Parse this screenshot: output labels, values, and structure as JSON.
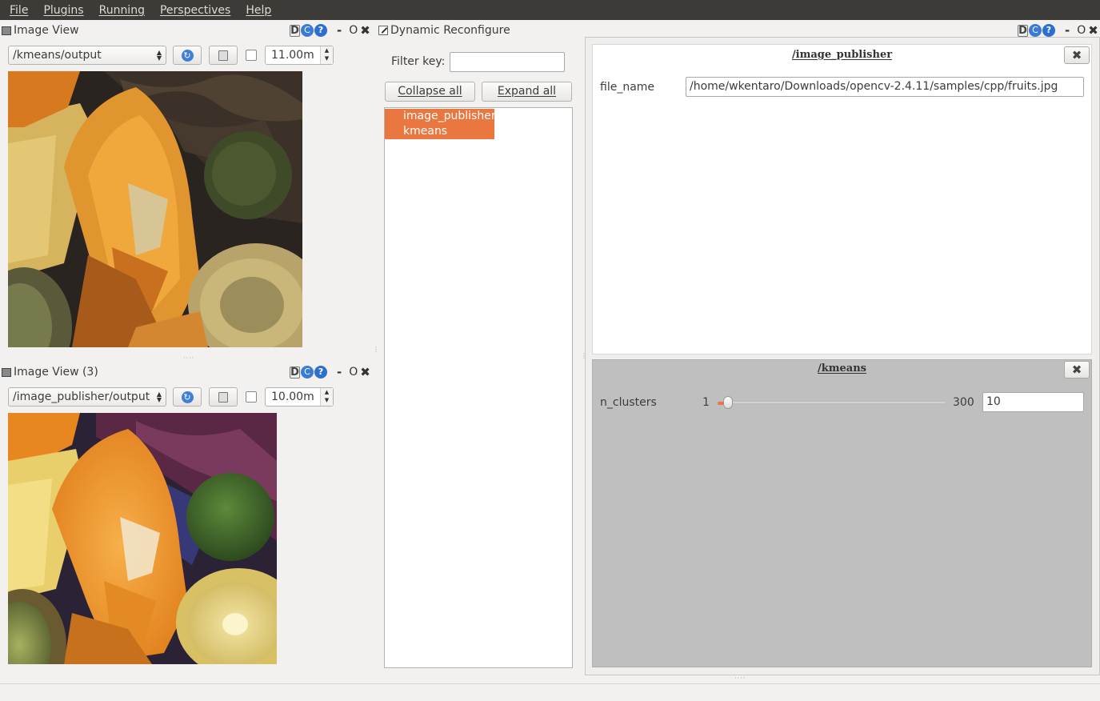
{
  "menubar": {
    "items": [
      "File",
      "Plugins",
      "Running",
      "Perspectives",
      "Help"
    ]
  },
  "image_view_1": {
    "title": "Image View",
    "topic": "/kmeans/output",
    "zoom_value": "11.00m"
  },
  "image_view_2": {
    "title": "Image View (3)",
    "topic": "/image_publisher/output",
    "zoom_value": "10.00m"
  },
  "dock_controls": {
    "d_label": "D",
    "c_label": "C",
    "help_label": "?",
    "min_label": "-",
    "float_label": "O",
    "close_label": "✖"
  },
  "dynamic_reconfigure": {
    "title": "Dynamic Reconfigure",
    "filter_label": "Filter key:",
    "filter_value": "",
    "collapse_label": "Collapse all",
    "expand_label": "Expand all",
    "tree_items": [
      "image_publisher",
      "kmeans"
    ]
  },
  "image_publisher_group": {
    "title": "/image_publisher",
    "param_name": "file_name",
    "param_value": "/home/wkentaro/Downloads/opencv-2.4.11/samples/cpp/fruits.jpg",
    "close_label": "✖"
  },
  "kmeans_group": {
    "title": "/kmeans",
    "param_name": "n_clusters",
    "min_label": "1",
    "max_label": "300",
    "value": "10",
    "slider_min": 1,
    "slider_max": 300,
    "slider_value": 10,
    "close_label": "✖"
  },
  "colors": {
    "accent": "#e9773f",
    "menubar": "#3c3b37",
    "group_bg_active": "#ffffff",
    "group_bg_inactive": "#bfbfbf"
  }
}
